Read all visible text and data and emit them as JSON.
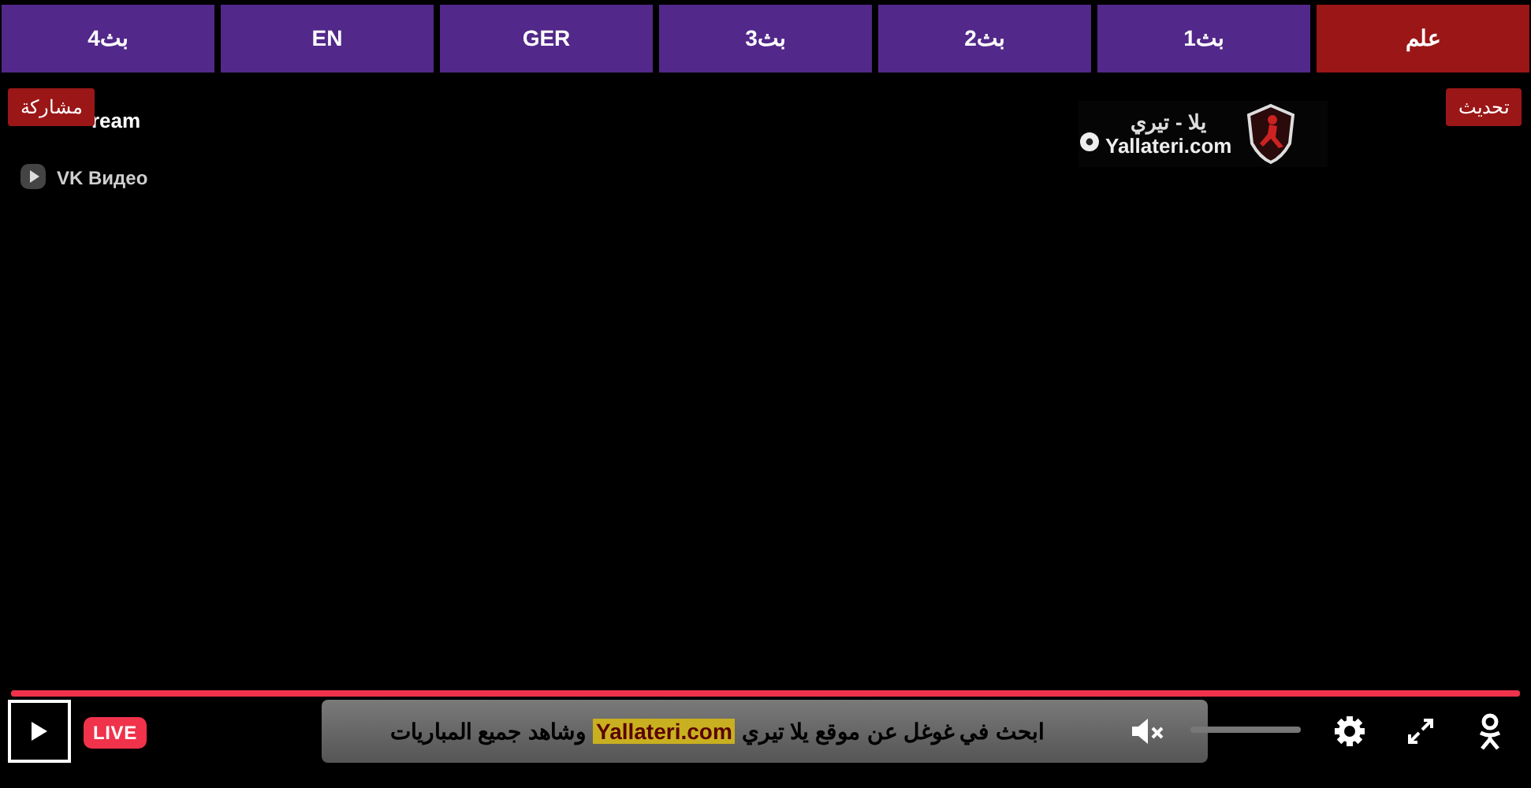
{
  "tabs": [
    {
      "label": "علم",
      "selected": true
    },
    {
      "label": "بث1",
      "selected": false
    },
    {
      "label": "بث2",
      "selected": false
    },
    {
      "label": "بث3",
      "selected": false
    },
    {
      "label": "GER",
      "selected": false
    },
    {
      "label": "EN",
      "selected": false
    },
    {
      "label": "بث4",
      "selected": false
    }
  ],
  "refresh_button": "تحديث",
  "share_button": "مشاركة",
  "stream_title": "ream",
  "vk_label": "VK Видео",
  "logo": {
    "arabic": "يلا - تيري",
    "latin": "Yallateri.com"
  },
  "player": {
    "progress": {
      "level": 1
    },
    "live_badge": "LIVE",
    "muted": true,
    "banner": {
      "start": "ابحث في غوغل عن موقع يلا تيري",
      "highlight": "Yallateri.com",
      "end": "وشاهد جميع المباريات"
    }
  }
}
